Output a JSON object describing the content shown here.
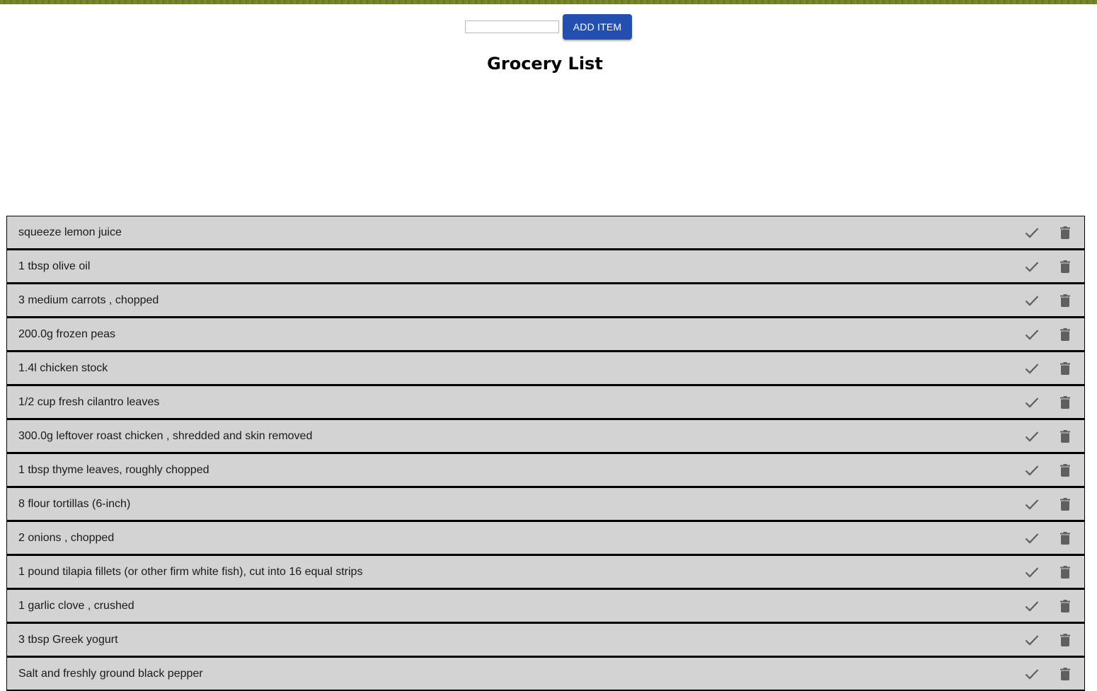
{
  "add_bar": {
    "input_value": "",
    "button_label": "ADD ITEM"
  },
  "page_title": "Grocery List",
  "colors": {
    "accent": "#2350b0",
    "row_background": "#d3d3d3",
    "top_band": "#6f7f24",
    "icon": "#5f5f5f"
  },
  "icons": {
    "complete": "check-icon",
    "delete": "trash-icon"
  },
  "items": [
    {
      "label": "squeeze lemon juice"
    },
    {
      "label": "1 tbsp olive oil"
    },
    {
      "label": "3 medium carrots , chopped"
    },
    {
      "label": "200.0g frozen peas"
    },
    {
      "label": "1.4l chicken stock"
    },
    {
      "label": "1/2 cup fresh cilantro leaves"
    },
    {
      "label": "300.0g leftover roast chicken , shredded and skin removed"
    },
    {
      "label": "1 tbsp thyme leaves, roughly chopped"
    },
    {
      "label": "8 flour tortillas (6-inch)"
    },
    {
      "label": "2 onions , chopped"
    },
    {
      "label": "1 pound tilapia fillets (or other firm white fish), cut into 16 equal strips"
    },
    {
      "label": "1 garlic clove , crushed"
    },
    {
      "label": "3 tbsp Greek yogurt"
    },
    {
      "label": "Salt and freshly ground black pepper"
    }
  ]
}
